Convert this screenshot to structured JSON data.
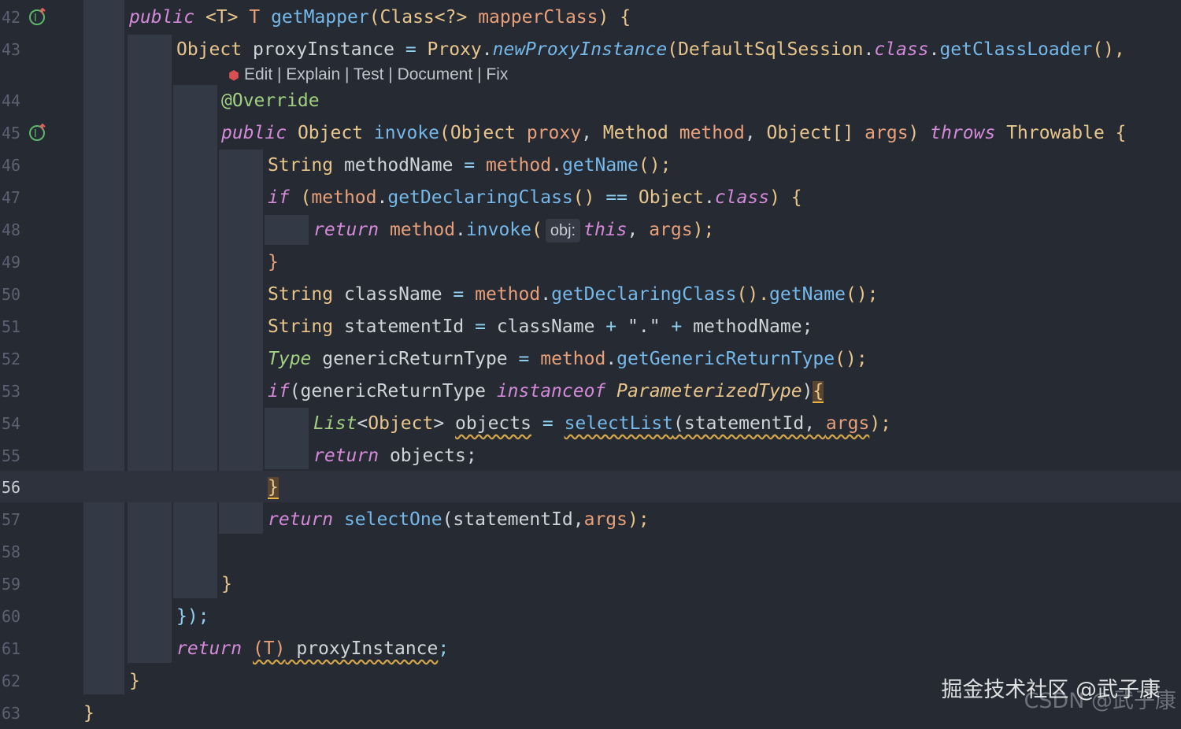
{
  "editor": {
    "line_numbers": [
      "42",
      "43",
      "44",
      "45",
      "46",
      "47",
      "48",
      "49",
      "50",
      "51",
      "52",
      "53",
      "54",
      "55",
      "56",
      "57",
      "58",
      "59",
      "60",
      "61",
      "62",
      "63"
    ],
    "active_line": "56",
    "code_lens": {
      "edit": "Edit",
      "sep1": " | ",
      "explain": "Explain",
      "sep2": " | ",
      "test": "Test",
      "sep3": " | ",
      "document": "Document",
      "sep4": " | ",
      "fix": "Fix"
    },
    "inlay_hint": "obj:",
    "gutter_icons": [
      "implementing-method-icon",
      "implementing-method-icon"
    ],
    "lines": {
      "l42": [
        "public",
        " <T> ",
        "T",
        " ",
        "getMapper",
        "(",
        "Class<?>",
        " ",
        "mapperClass",
        ") {"
      ],
      "l43": [
        "Object",
        " proxyInstance ",
        "=",
        " ",
        "Proxy",
        ".",
        "newProxyInstance",
        "(",
        "DefaultSqlSession",
        ".",
        "class",
        ".",
        "getClassLoader",
        "(),"
      ],
      "l44": [
        "@Override"
      ],
      "l45": [
        "public",
        " ",
        "Object",
        " ",
        "invoke",
        "(",
        "Object",
        " ",
        "proxy",
        ", ",
        "Method",
        " ",
        "method",
        ", ",
        "Object[]",
        " ",
        "args",
        ") ",
        "throws",
        " ",
        "Throwable",
        " {"
      ],
      "l46": [
        "String",
        " methodName ",
        "=",
        " ",
        "method",
        ".",
        "getName",
        "();"
      ],
      "l47": [
        "if",
        " (",
        "method",
        ".",
        "getDeclaringClass",
        "() ",
        "==",
        " ",
        "Object",
        ".",
        "class",
        ") {"
      ],
      "l48": [
        "return",
        " ",
        "method",
        ".",
        "invoke",
        "(",
        "this",
        ", ",
        "args",
        ");"
      ],
      "l49": [
        "}"
      ],
      "l50": [
        "String",
        " className ",
        "=",
        " ",
        "method",
        ".",
        "getDeclaringClass",
        "().",
        "getName",
        "();"
      ],
      "l51": [
        "String",
        " statementId ",
        "=",
        " className ",
        "+",
        " ",
        "\".\"",
        " ",
        "+",
        " methodName;"
      ],
      "l52": [
        "Type",
        " genericReturnType ",
        "=",
        " ",
        "method",
        ".",
        "getGenericReturnType",
        "();"
      ],
      "l53": [
        "if",
        "(genericReturnType ",
        "instanceof",
        " ",
        "ParameterizedType",
        ")",
        "{"
      ],
      "l54": [
        "List",
        "<",
        "Object",
        "> ",
        "objects",
        " ",
        "=",
        " ",
        "selectList",
        "(statementId, ",
        "args",
        ");"
      ],
      "l55": [
        "return",
        " objects;"
      ],
      "l56": [
        "}"
      ],
      "l57": [
        "return",
        " ",
        "selectOne",
        "(statementId,",
        "args",
        ");"
      ],
      "l59": [
        "}"
      ],
      "l60": [
        "});"
      ],
      "l61": [
        "return",
        " ",
        "(T)",
        " proxyInstance",
        ";"
      ],
      "l62": [
        "}"
      ],
      "l63": [
        "}"
      ]
    }
  },
  "watermark": {
    "text1": "掘金技术社区 @武子康",
    "text2": "CSDN @武子康"
  },
  "colors": {
    "background": "#262a33",
    "keyword": "#d48ad8",
    "type": "#e8c58a",
    "function": "#75b8ea",
    "parameter": "#e8a07a",
    "annotation": "#a0d080",
    "current_line": "#2d323c"
  }
}
